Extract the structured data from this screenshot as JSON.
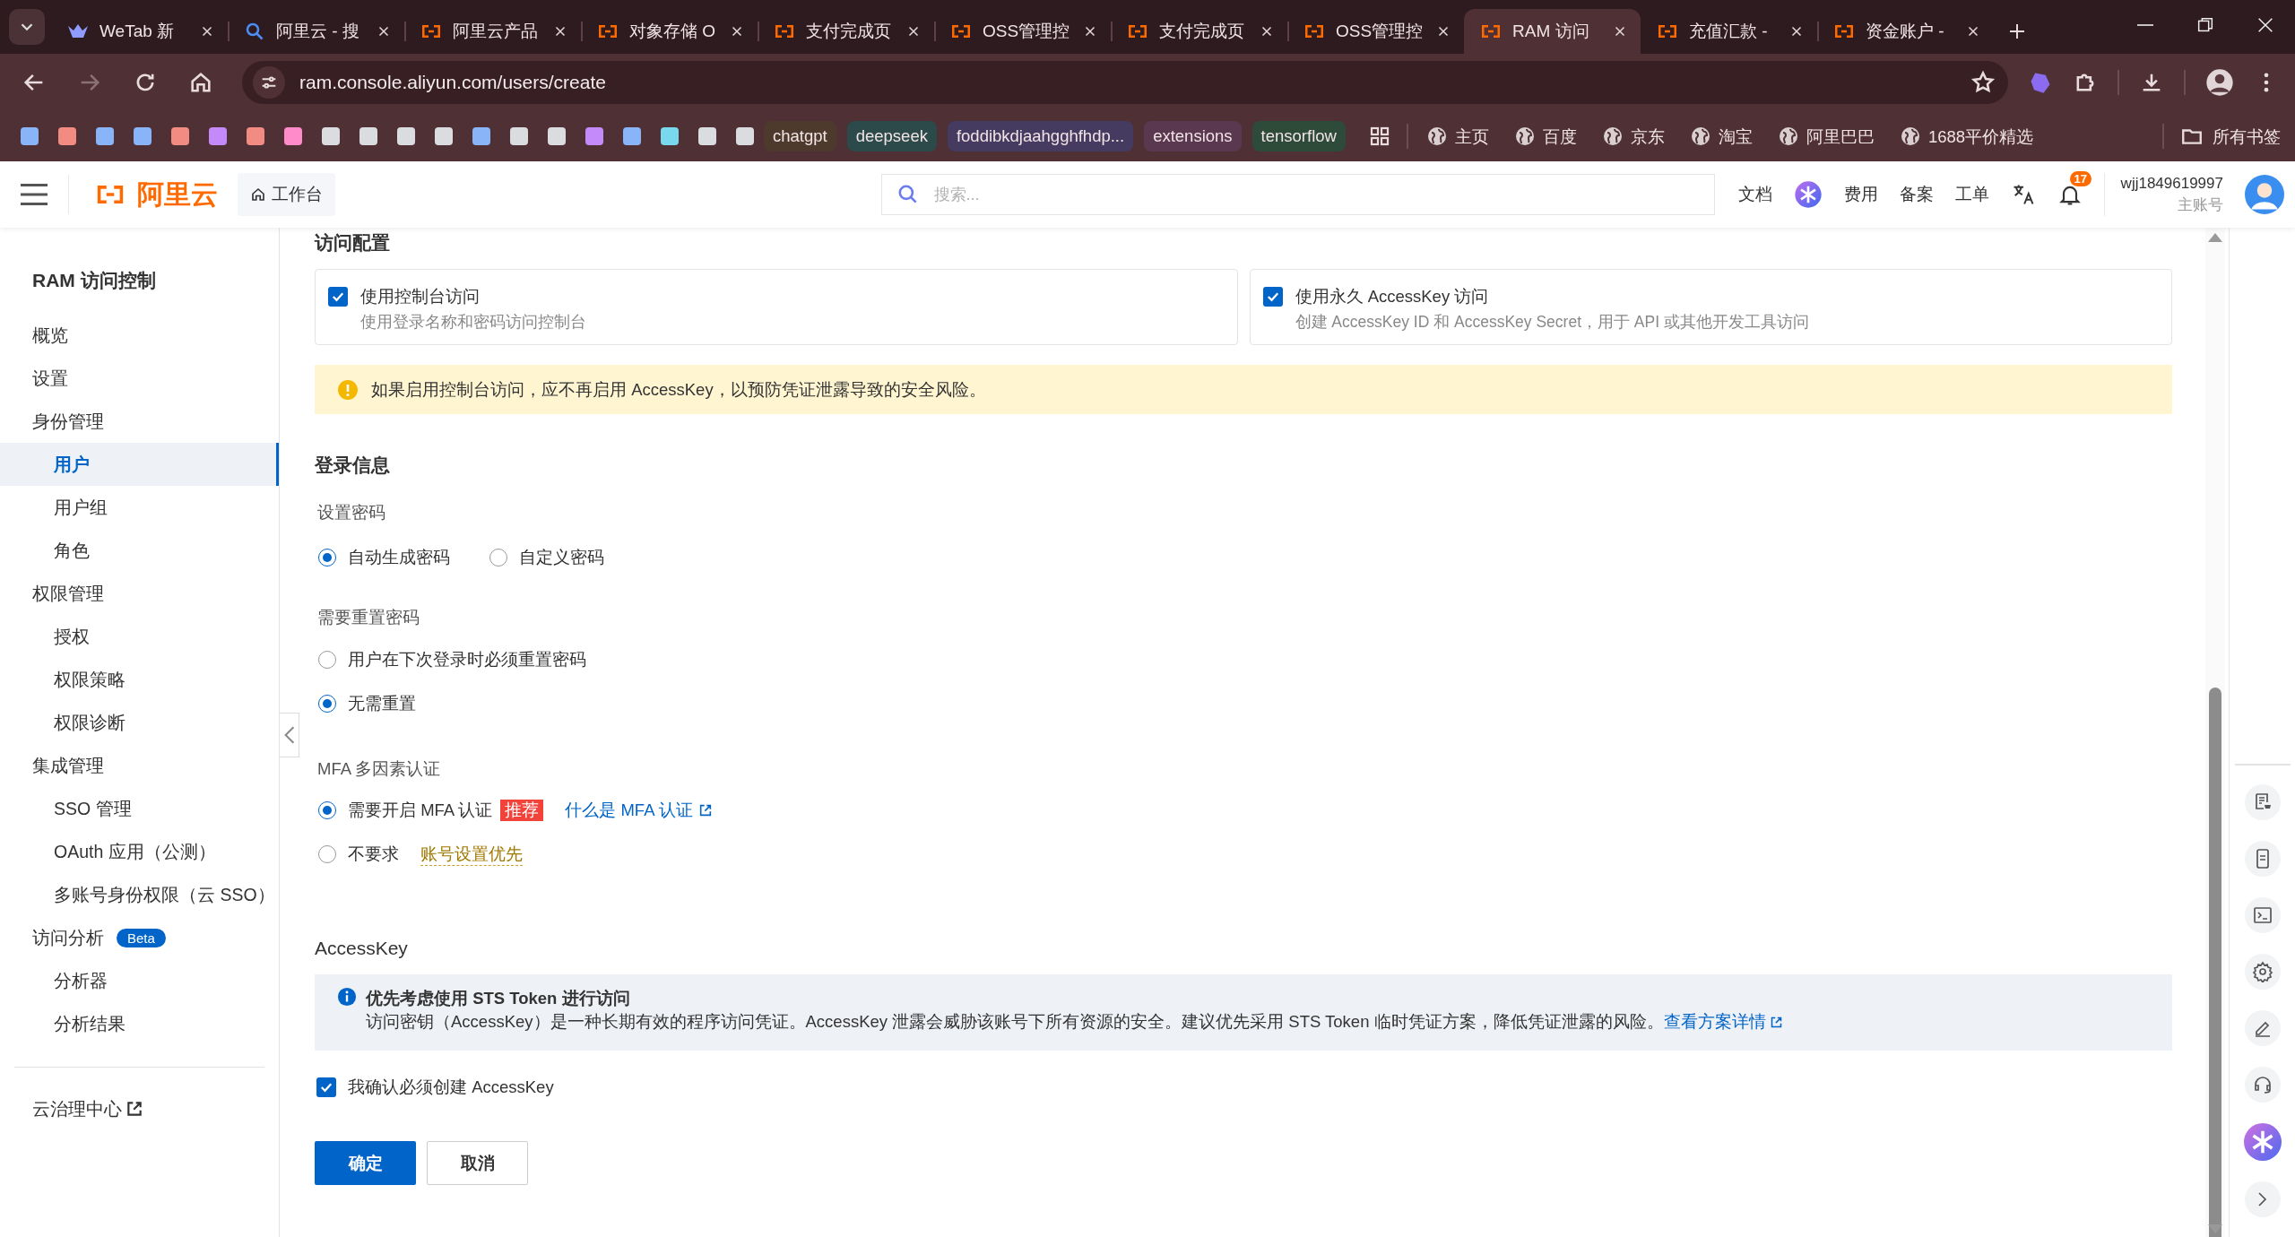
{
  "browser": {
    "tabs": [
      {
        "title": "WeTab 新",
        "kind": "wetab",
        "selected": false
      },
      {
        "title": "阿里云 - 搜",
        "kind": "search",
        "selected": false
      },
      {
        "title": "阿里云产品",
        "kind": "aliyun",
        "selected": false
      },
      {
        "title": "对象存储 O",
        "kind": "aliyun",
        "selected": false
      },
      {
        "title": "支付完成页",
        "kind": "aliyun",
        "selected": false
      },
      {
        "title": "OSS管理控",
        "kind": "aliyun",
        "selected": false
      },
      {
        "title": "支付完成页",
        "kind": "aliyun",
        "selected": false
      },
      {
        "title": "OSS管理控",
        "kind": "aliyun",
        "selected": false
      },
      {
        "title": "RAM 访问",
        "kind": "aliyun",
        "selected": true
      },
      {
        "title": "充值汇款 -",
        "kind": "aliyun",
        "selected": false
      },
      {
        "title": "资金账户 -",
        "kind": "aliyun",
        "selected": false
      }
    ],
    "address": "ram.console.aliyun.com/users/create",
    "bookmarks": [
      {
        "kind": "swatch",
        "color": "#8ab4f8"
      },
      {
        "kind": "swatch",
        "color": "#f28b82"
      },
      {
        "kind": "swatch",
        "color": "#8ab4f8"
      },
      {
        "kind": "swatch",
        "color": "#8ab4f8"
      },
      {
        "kind": "swatch",
        "color": "#f28b82"
      },
      {
        "kind": "swatch",
        "color": "#c58af9"
      },
      {
        "kind": "swatch",
        "color": "#f28b82"
      },
      {
        "kind": "swatch",
        "color": "#ff8bcb"
      },
      {
        "kind": "swatch",
        "color": "#dadce0"
      },
      {
        "kind": "swatch",
        "color": "#dadce0"
      },
      {
        "kind": "swatch",
        "color": "#dadce0"
      },
      {
        "kind": "swatch",
        "color": "#dadce0"
      },
      {
        "kind": "swatch",
        "color": "#8ab4f8"
      },
      {
        "kind": "swatch",
        "color": "#dadce0"
      },
      {
        "kind": "swatch",
        "color": "#dadce0"
      },
      {
        "kind": "swatch",
        "color": "#c58af9"
      },
      {
        "kind": "swatch",
        "color": "#8ab4f8"
      },
      {
        "kind": "swatch",
        "color": "#78d9ec"
      },
      {
        "kind": "swatch",
        "color": "#dadce0"
      },
      {
        "kind": "swatch",
        "color": "#dadce0"
      },
      {
        "kind": "chip",
        "label": "chatgpt",
        "color": "#4e3a2c"
      },
      {
        "kind": "chip",
        "label": "deepseek",
        "color": "#2d4a4a"
      },
      {
        "kind": "chip",
        "label": "foddibkdjaahgghfhdp...",
        "color": "#453a60"
      },
      {
        "kind": "chip",
        "label": "extensions",
        "color": "#5a3850"
      },
      {
        "kind": "chip",
        "label": "tensorflow",
        "color": "#2e4a38"
      },
      {
        "kind": "apps"
      },
      {
        "kind": "site",
        "label": "主页"
      },
      {
        "kind": "site",
        "label": "百度"
      },
      {
        "kind": "site",
        "label": "京东"
      },
      {
        "kind": "site",
        "label": "淘宝"
      },
      {
        "kind": "site",
        "label": "阿里巴巴"
      },
      {
        "kind": "site",
        "label": "1688平价精选"
      }
    ],
    "all_bookmarks": "所有书签"
  },
  "header": {
    "logo": "阿里云",
    "workbench": "工作台",
    "search_placeholder": "搜索...",
    "nav": [
      {
        "kind": "link",
        "label": "文档"
      },
      {
        "kind": "ai"
      },
      {
        "kind": "link",
        "label": "费用"
      },
      {
        "kind": "link",
        "label": "备案"
      },
      {
        "kind": "link",
        "label": "工单"
      },
      {
        "kind": "translate"
      }
    ],
    "notifications": "17",
    "user": {
      "name": "wjj1849619997",
      "role": "主账号"
    }
  },
  "sidebar": {
    "title": "RAM 访问控制",
    "items": [
      {
        "label": "概览",
        "selected": false
      },
      {
        "label": "设置",
        "selected": false
      },
      {
        "label": "身份管理",
        "selected": false,
        "children": [
          {
            "label": "用户",
            "selected": true
          },
          {
            "label": "用户组",
            "selected": false
          },
          {
            "label": "角色",
            "selected": false
          }
        ]
      },
      {
        "label": "权限管理",
        "selected": false,
        "children": [
          {
            "label": "授权",
            "selected": false
          },
          {
            "label": "权限策略",
            "selected": false
          },
          {
            "label": "权限诊断",
            "selected": false
          }
        ]
      },
      {
        "label": "集成管理",
        "selected": false,
        "children": [
          {
            "label": "SSO 管理",
            "selected": false
          },
          {
            "label": "OAuth 应用（公测）",
            "selected": false
          },
          {
            "label": "多账号身份权限（云 SSO）",
            "selected": false
          }
        ]
      },
      {
        "label": "访问分析",
        "badge": "Beta",
        "selected": false,
        "children": [
          {
            "label": "分析器",
            "selected": false
          },
          {
            "label": "分析结果",
            "selected": false
          }
        ]
      }
    ],
    "footer_link": "云治理中心"
  },
  "form": {
    "access_config": {
      "heading": "访问配置",
      "options": [
        {
          "title": "使用控制台访问",
          "description": "使用登录名称和密码访问控制台",
          "checked": true
        },
        {
          "title": "使用永久 AccessKey 访问",
          "description": "创建 AccessKey ID 和 AccessKey Secret，用于 API 或其他开发工具访问",
          "checked": true
        }
      ],
      "warning": "如果启用控制台访问，应不再启用 AccessKey，以预防凭证泄露导致的安全风险。"
    },
    "login_info": {
      "heading": "登录信息",
      "groups": [
        {
          "label": "设置密码",
          "kind": "inline",
          "options": [
            {
              "label": "自动生成密码",
              "selected": true
            },
            {
              "label": "自定义密码",
              "selected": false
            }
          ]
        },
        {
          "label": "需要重置密码",
          "kind": "stacked",
          "options": [
            {
              "label": "用户在下次登录时必须重置密码",
              "selected": false
            },
            {
              "label": "无需重置",
              "selected": true
            }
          ]
        },
        {
          "label": "MFA 多因素认证",
          "kind": "stacked",
          "options": [
            {
              "label": "需要开启 MFA 认证",
              "selected": true,
              "tag": "推荐",
              "link": "什么是 MFA 认证"
            },
            {
              "label": "不要求",
              "selected": false,
              "hint": "账号设置优先"
            }
          ]
        }
      ]
    },
    "access_key": {
      "heading": "AccessKey",
      "info_title": "优先考虑使用 STS Token 进行访问",
      "info_text": "访问密钥（AccessKey）是一种长期有效的程序访问凭证。AccessKey 泄露会威胁该账号下所有资源的安全。建议优先采用 STS Token 临时凭证方案，降低凭证泄露的风险。",
      "info_link": "查看方案详情",
      "confirm": {
        "label": "我确认必须创建 AccessKey",
        "checked": true
      }
    },
    "buttons": [
      {
        "label": "确定",
        "kind": "primary"
      },
      {
        "label": "取消",
        "kind": "default"
      }
    ]
  }
}
